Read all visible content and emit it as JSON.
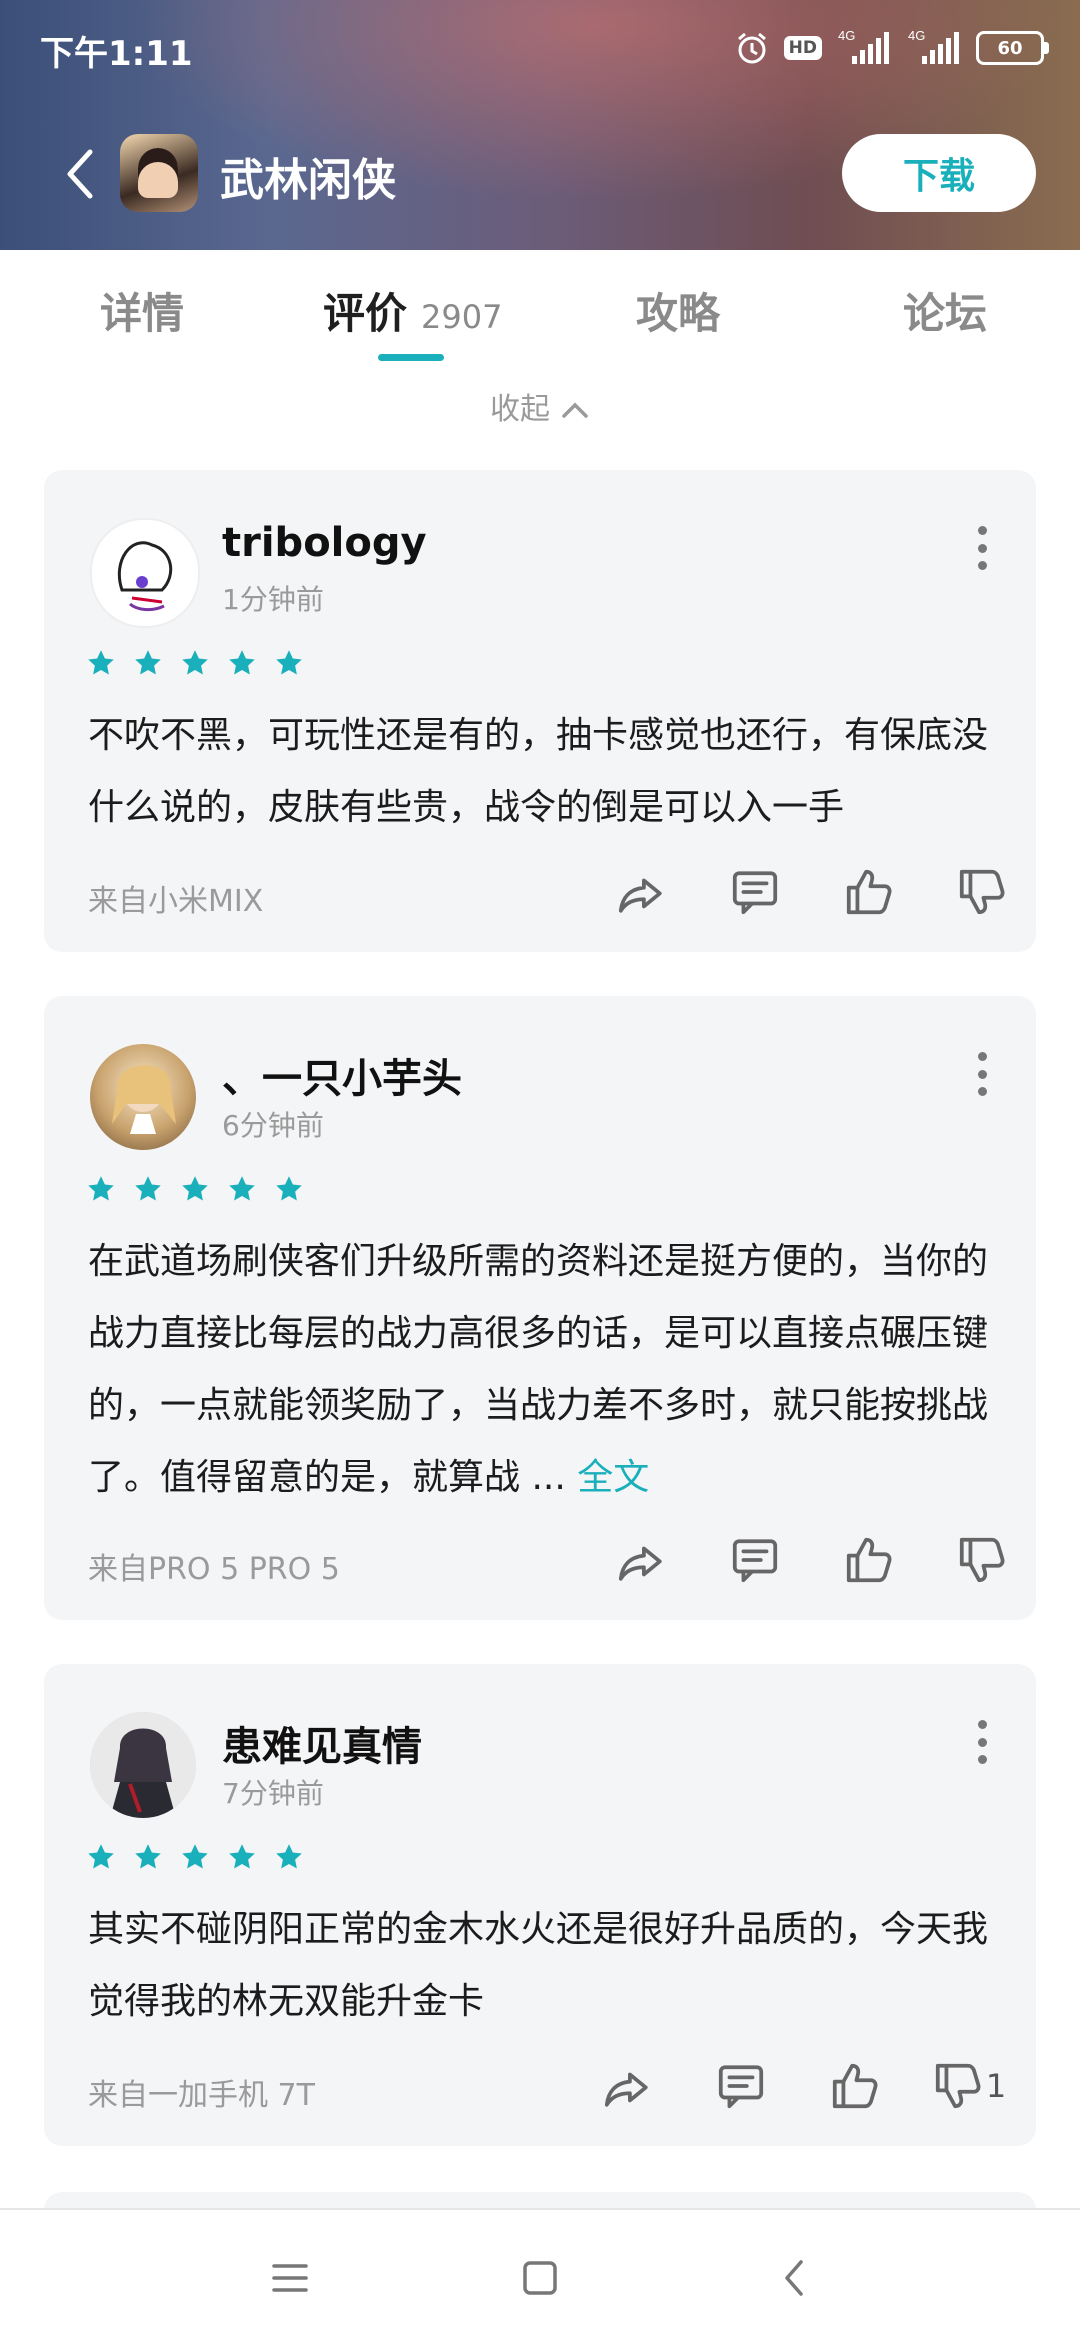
{
  "status_bar": {
    "time": "下午1:11",
    "hd": "HD",
    "network1": "4G",
    "network2": "4G",
    "battery": "60"
  },
  "header": {
    "app_title": "武林闲侠",
    "download_label": "下载"
  },
  "tabs": [
    {
      "label": "详情"
    },
    {
      "label": "评价",
      "count": "2907"
    },
    {
      "label": "攻略"
    },
    {
      "label": "论坛"
    }
  ],
  "collapse_label": "收起",
  "reviews": [
    {
      "username": "tribology",
      "time": "1分钟前",
      "rating": 5,
      "text": "不吹不黑，可玩性还是有的，抽卡感觉也还行，有保底没什么说的，皮肤有些贵，战令的倒是可以入一手",
      "source": "来自小米MIX",
      "dislike_count": ""
    },
    {
      "username": "、一只小芋头",
      "time": "6分钟前",
      "rating": 5,
      "text": "在武道场刷侠客们升级所需的资料还是挺方便的，当你的战力直接比每层的战力高很多的话，是可以直接点碾压键的，一点就能领奖励了，当战力差不多时，就只能按挑战了。值得留意的是，就算战 ... ",
      "more_label": "全文",
      "source": "来自PRO 5 PRO 5",
      "dislike_count": ""
    },
    {
      "username": "患难见真情",
      "time": "7分钟前",
      "rating": 5,
      "text": "其实不碰阴阳正常的金木水火还是很好升品质的，今天我觉得我的林无双能升金卡",
      "source": "来自一加手机 7T",
      "dislike_count": "1"
    }
  ],
  "colors": {
    "accent": "#1ab0bb",
    "card_bg": "#f4f5f7"
  }
}
